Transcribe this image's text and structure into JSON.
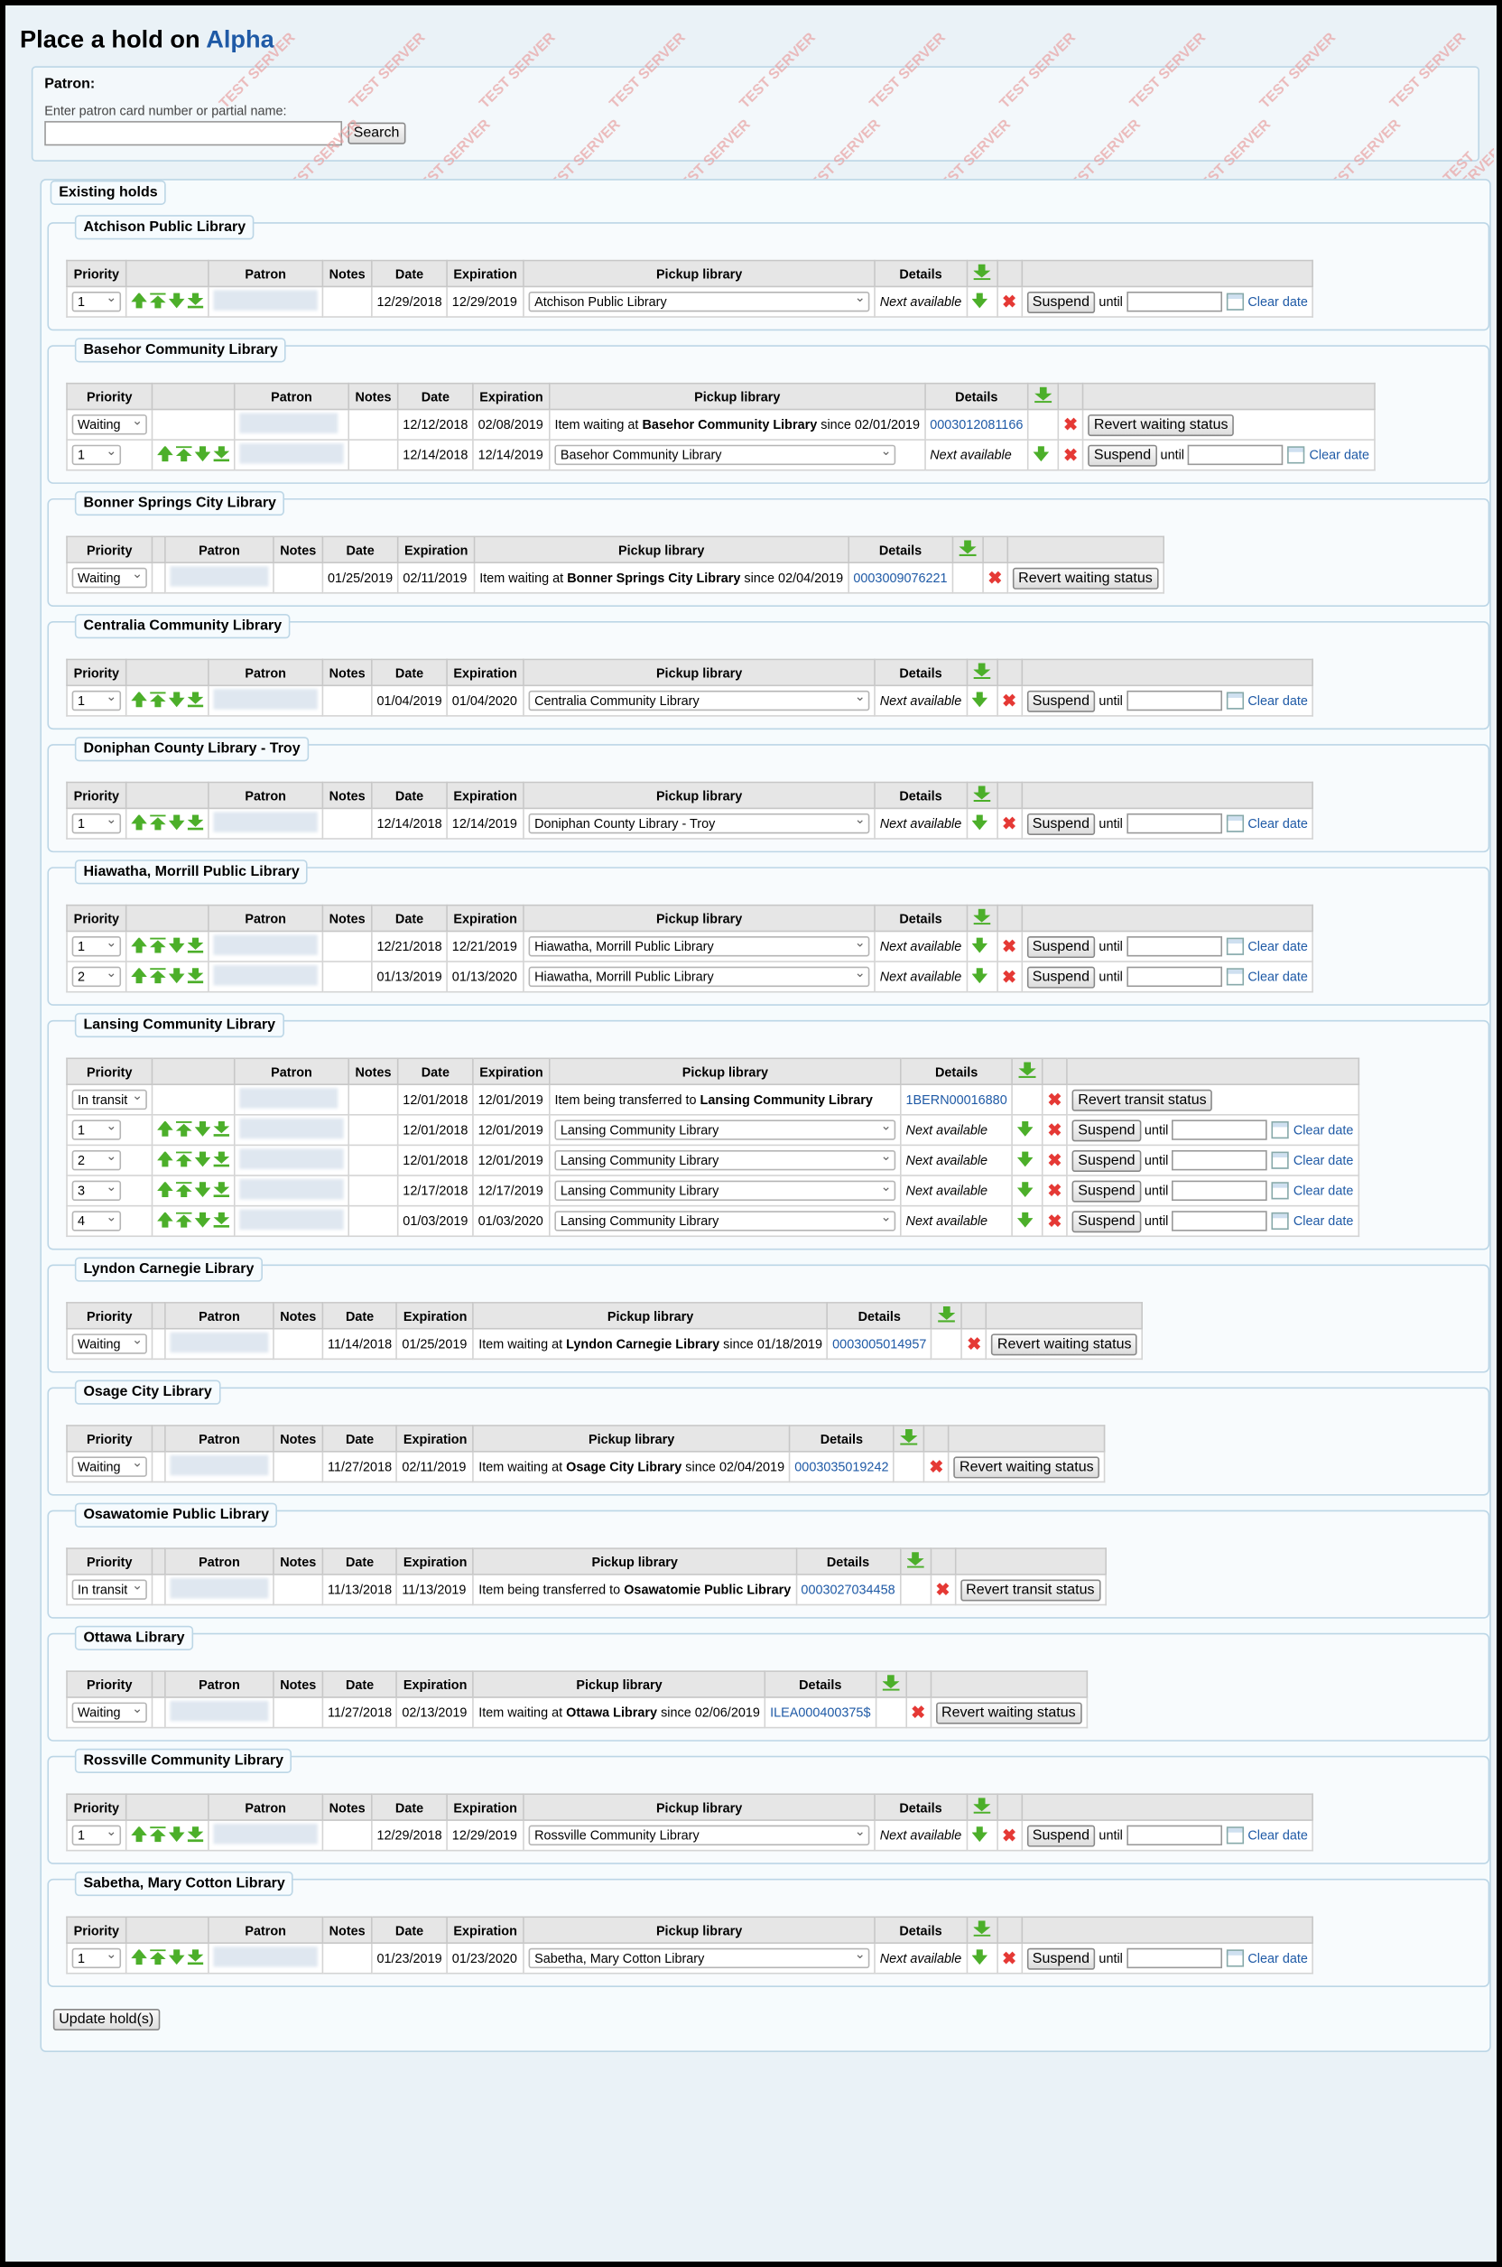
{
  "title_prefix": "Place a hold on",
  "title_item": "Alpha",
  "watermark": "TEST SERVER",
  "patron": {
    "label": "Patron:",
    "hint": "Enter patron card number or partial name:",
    "search_label": "Search"
  },
  "existing_label": "Existing holds",
  "headers": {
    "priority": "Priority",
    "patron": "Patron",
    "notes": "Notes",
    "date": "Date",
    "expiration": "Expiration",
    "pickup": "Pickup library",
    "details": "Details"
  },
  "labels": {
    "suspend": "Suspend",
    "until": "until",
    "clear_date": "Clear date",
    "next_available": "Next available",
    "revert_waiting": "Revert waiting status",
    "revert_transit": "Revert transit status",
    "waiting_at": "Item waiting at",
    "since": "since",
    "transferred_to": "Item being transferred to",
    "update": "Update hold(s)"
  },
  "branches": [
    {
      "name": "Atchison Public Library",
      "rows": [
        {
          "type": "normal",
          "priority": "1",
          "date": "12/29/2018",
          "expiration": "12/29/2019",
          "pickup": "Atchison Public Library"
        }
      ]
    },
    {
      "name": "Basehor Community Library",
      "rows": [
        {
          "type": "waiting",
          "priority": "Waiting",
          "date": "12/12/2018",
          "expiration": "02/08/2019",
          "location": "Basehor Community Library",
          "since": "02/01/2019",
          "barcode": "0003012081166"
        },
        {
          "type": "normal",
          "priority": "1",
          "date": "12/14/2018",
          "expiration": "12/14/2019",
          "pickup": "Basehor Community Library"
        }
      ]
    },
    {
      "name": "Bonner Springs City Library",
      "rows": [
        {
          "type": "waiting",
          "priority": "Waiting",
          "date": "01/25/2019",
          "expiration": "02/11/2019",
          "location": "Bonner Springs City Library",
          "since": "02/04/2019",
          "barcode": "0003009076221"
        }
      ]
    },
    {
      "name": "Centralia Community Library",
      "rows": [
        {
          "type": "normal",
          "priority": "1",
          "date": "01/04/2019",
          "expiration": "01/04/2020",
          "pickup": "Centralia Community Library"
        }
      ]
    },
    {
      "name": "Doniphan County Library - Troy",
      "rows": [
        {
          "type": "normal",
          "priority": "1",
          "date": "12/14/2018",
          "expiration": "12/14/2019",
          "pickup": "Doniphan County Library - Troy"
        }
      ]
    },
    {
      "name": "Hiawatha, Morrill Public Library",
      "rows": [
        {
          "type": "normal",
          "priority": "1",
          "date": "12/21/2018",
          "expiration": "12/21/2019",
          "pickup": "Hiawatha, Morrill Public Library"
        },
        {
          "type": "normal",
          "priority": "2",
          "date": "01/13/2019",
          "expiration": "01/13/2020",
          "pickup": "Hiawatha, Morrill Public Library"
        }
      ]
    },
    {
      "name": "Lansing Community Library",
      "rows": [
        {
          "type": "transit",
          "priority": "In transit",
          "date": "12/01/2018",
          "expiration": "12/01/2019",
          "location": "Lansing Community Library",
          "barcode": "1BERN00016880"
        },
        {
          "type": "normal",
          "priority": "1",
          "date": "12/01/2018",
          "expiration": "12/01/2019",
          "pickup": "Lansing Community Library"
        },
        {
          "type": "normal",
          "priority": "2",
          "date": "12/01/2018",
          "expiration": "12/01/2019",
          "pickup": "Lansing Community Library"
        },
        {
          "type": "normal",
          "priority": "3",
          "date": "12/17/2018",
          "expiration": "12/17/2019",
          "pickup": "Lansing Community Library"
        },
        {
          "type": "normal",
          "priority": "4",
          "date": "01/03/2019",
          "expiration": "01/03/2020",
          "pickup": "Lansing Community Library"
        }
      ]
    },
    {
      "name": "Lyndon Carnegie Library",
      "rows": [
        {
          "type": "waiting",
          "priority": "Waiting",
          "date": "11/14/2018",
          "expiration": "01/25/2019",
          "location": "Lyndon Carnegie Library",
          "since": "01/18/2019",
          "barcode": "0003005014957"
        }
      ]
    },
    {
      "name": "Osage City Library",
      "rows": [
        {
          "type": "waiting",
          "priority": "Waiting",
          "date": "11/27/2018",
          "expiration": "02/11/2019",
          "location": "Osage City Library",
          "since": "02/04/2019",
          "barcode": "0003035019242"
        }
      ]
    },
    {
      "name": "Osawatomie Public Library",
      "rows": [
        {
          "type": "transit",
          "priority": "In transit",
          "date": "11/13/2018",
          "expiration": "11/13/2019",
          "location": "Osawatomie Public Library",
          "barcode": "0003027034458"
        }
      ]
    },
    {
      "name": "Ottawa Library",
      "rows": [
        {
          "type": "waiting",
          "priority": "Waiting",
          "date": "11/27/2018",
          "expiration": "02/13/2019",
          "location": "Ottawa Library",
          "since": "02/06/2019",
          "barcode": "ILEA000400375$"
        }
      ]
    },
    {
      "name": "Rossville Community Library",
      "rows": [
        {
          "type": "normal",
          "priority": "1",
          "date": "12/29/2018",
          "expiration": "12/29/2019",
          "pickup": "Rossville Community Library"
        }
      ]
    },
    {
      "name": "Sabetha, Mary Cotton Library",
      "rows": [
        {
          "type": "normal",
          "priority": "1",
          "date": "01/23/2019",
          "expiration": "01/23/2020",
          "pickup": "Sabetha, Mary Cotton Library"
        }
      ]
    }
  ]
}
